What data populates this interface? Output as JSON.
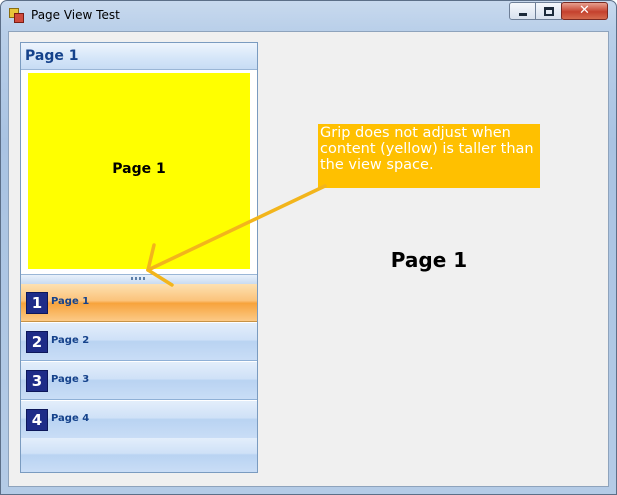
{
  "window": {
    "title": "Page View Test",
    "controls": {
      "minimize": "minimize",
      "maximize": "maximize",
      "close": "✕"
    }
  },
  "page_view": {
    "header_label": "Page 1",
    "content_label": "Page 1",
    "items": [
      {
        "number": "1",
        "label": "Page 1",
        "selected": true
      },
      {
        "number": "2",
        "label": "Page 2",
        "selected": false
      },
      {
        "number": "3",
        "label": "Page 3",
        "selected": false
      },
      {
        "number": "4",
        "label": "Page 4",
        "selected": false
      }
    ]
  },
  "main_label": "Page 1",
  "annotation": {
    "text": "Grip does not adjust when content (yellow) is taller than the view space.",
    "color": "#ffc000"
  },
  "colors": {
    "content_fill": "#ffff00",
    "selected_item": "#f7a33c",
    "badge": "#1e2c88",
    "header_text": "#15428b"
  }
}
